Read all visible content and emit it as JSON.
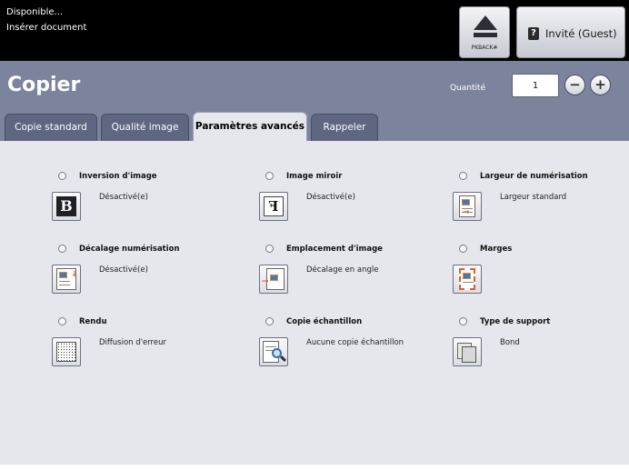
{
  "status": {
    "line1": "Disponible...",
    "line2": "Insérer document"
  },
  "header": {
    "pkback_label": "PKBACK#",
    "guest_label": "Invité (Guest)"
  },
  "page": {
    "title": "Copier",
    "quantity_label": "Quantité",
    "quantity_value": "1"
  },
  "tabs": [
    {
      "label": "Copie standard",
      "active": false
    },
    {
      "label": "Qualité image",
      "active": false
    },
    {
      "label": "Paramètres avancés",
      "active": true
    },
    {
      "label": "Rappeler",
      "active": false
    }
  ],
  "features": [
    {
      "title": "Inversion d'image",
      "value": "Désactivé(e)",
      "icon": "invert-image-icon"
    },
    {
      "title": "Image miroir",
      "value": "Désactivé(e)",
      "icon": "mirror-image-icon"
    },
    {
      "title": "Largeur de numérisation",
      "value": "Largeur standard",
      "icon": "scan-width-icon"
    },
    {
      "title": "Décalage numérisation",
      "value": "Désactivé(e)",
      "icon": "scan-shift-icon"
    },
    {
      "title": "Emplacement d'image",
      "value": "Décalage en angle",
      "icon": "image-placement-icon"
    },
    {
      "title": "Marges",
      "value": "",
      "icon": "margins-icon"
    },
    {
      "title": "Rendu",
      "value": "Diffusion d'erreur",
      "icon": "rendering-icon"
    },
    {
      "title": "Copie échantillon",
      "value": "Aucune copie échantillon",
      "icon": "sample-copy-icon"
    },
    {
      "title": "Type de support",
      "value": "Bond",
      "icon": "media-type-icon"
    }
  ]
}
